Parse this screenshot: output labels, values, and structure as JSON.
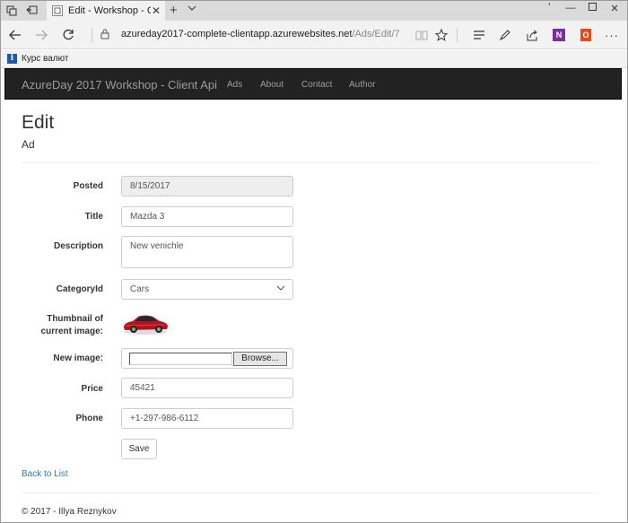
{
  "browser": {
    "tab_title": "Edit - Workshop - Client",
    "url_host": "azureday2017-complete-clientapp.azurewebsites.net",
    "url_path": "/Ads/Edit/7",
    "favorite_label": "Курс валют",
    "favorite_icon_glyph": "i",
    "onenote_glyph": "N",
    "office_glyph": "O"
  },
  "site": {
    "brand": "AzureDay 2017 Workshop - Client Api",
    "nav": [
      "Ads",
      "About",
      "Contact",
      "Author"
    ]
  },
  "page": {
    "title": "Edit",
    "subtitle": "Ad"
  },
  "form": {
    "posted_label": "Posted",
    "posted_value": "8/15/2017",
    "title_label": "Title",
    "title_value": "Mazda 3",
    "description_label": "Description",
    "description_value": "New venichle",
    "category_label": "CategoryId",
    "category_value": "Cars",
    "thumbnail_label": "Thumbnail of current image:",
    "new_image_label": "New image:",
    "browse_label": "Browse...",
    "price_label": "Price",
    "price_value": "45421",
    "phone_label": "Phone",
    "phone_value": "+1-297-986-6112",
    "save_label": "Save"
  },
  "back_link": "Back to List",
  "footer": "© 2017 - Illya Reznykov",
  "colors": {
    "navbar_bg": "#222222",
    "link": "#337ab7",
    "onenote": "#7b2f9e",
    "office": "#e64a19"
  }
}
